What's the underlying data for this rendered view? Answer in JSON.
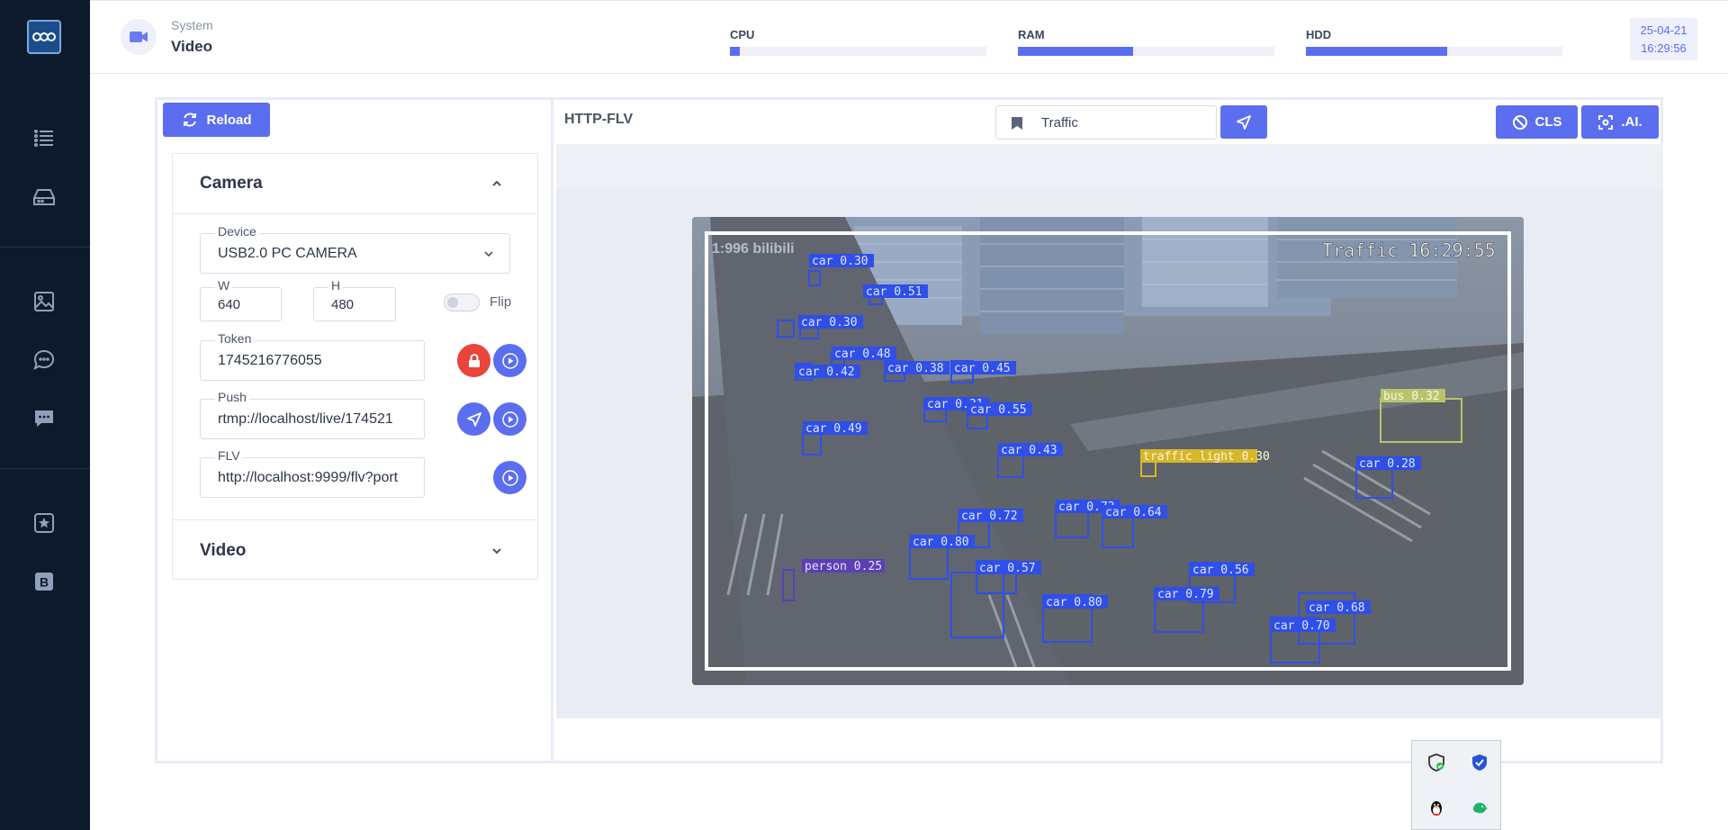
{
  "header": {
    "subtitle": "System",
    "title": "Video",
    "title_icon": "video-camera-icon",
    "meters": [
      {
        "label": "CPU",
        "value_percent": 4
      },
      {
        "label": "RAM",
        "value_percent": 45
      },
      {
        "label": "HDD",
        "value_percent": 55
      }
    ],
    "date": "25-04-21",
    "time": "16:29:56"
  },
  "sidebar": {
    "logo": "logo-icon",
    "items": [
      {
        "icon": "list-icon"
      },
      {
        "icon": "hard-drive-icon"
      },
      {
        "icon": "image-icon"
      },
      {
        "icon": "chat-bubble-icon"
      },
      {
        "icon": "message-square-icon"
      },
      {
        "icon": "star-icon"
      },
      {
        "icon": "b-icon"
      }
    ]
  },
  "controls": {
    "reload_label": "Reload",
    "camera_section": "Camera",
    "video_section": "Video",
    "device_label": "Device",
    "device_value": "USB2.0 PC CAMERA",
    "w_label": "W",
    "w_value": "640",
    "h_label": "H",
    "h_value": "480",
    "flip_label": "Flip",
    "flip_on": false,
    "token_label": "Token",
    "token_value": "1745216776055",
    "push_label": "Push",
    "push_value": "rtmp://localhost/live/174521",
    "flv_label": "FLV",
    "flv_value": "http://localhost:9999/flv?port"
  },
  "player": {
    "protocol_label": "HTTP-FLV",
    "tag_value": "Traffic",
    "cls_label": "CLS",
    "ai_label": ".AI.",
    "overlay_text": "Traffic 16:29:55",
    "corner_text": "1:996 bilibili",
    "detections": [
      "car 0.30",
      "car 0.51",
      "car 0.30",
      "car 0.48",
      "car 0.42",
      "car 0.38",
      "car 0.45",
      "car 0.31",
      "car 0.55",
      "car 0.49",
      "car 0.43",
      "traffic light 0.30",
      "bus 0.32",
      "car 0.28",
      "car 0.72",
      "car 0.73",
      "car 0.64",
      "car 0.80",
      "person 0.25",
      "car 0.57",
      "car 0.80",
      "car 0.79",
      "car 0.56",
      "car 0.68",
      "car 0.70"
    ]
  },
  "colors": {
    "accent": "#5b6ef0",
    "sidebar_bg": "#0c1a2b",
    "danger": "#e8453c",
    "box_car": "#2f4fe8",
    "box_bus": "#b9c46a",
    "box_traffic_light": "#d6b62a",
    "box_person": "#5b3fb5"
  }
}
